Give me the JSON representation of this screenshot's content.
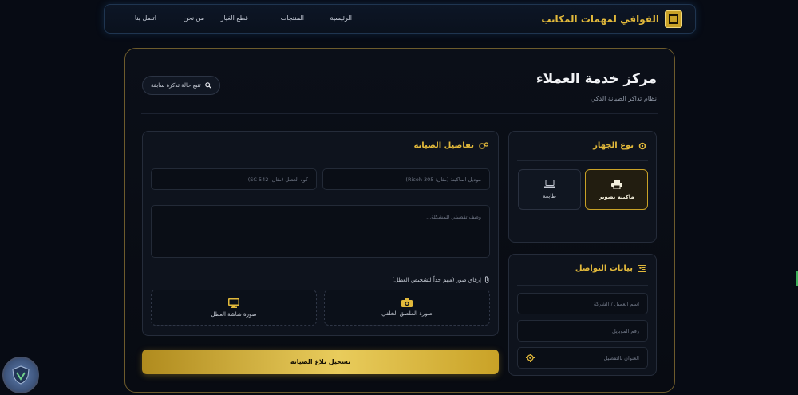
{
  "nav": {
    "brand": "الفوافي لمهمات المكاتب",
    "brand_logo_text": "الفوافي",
    "links": [
      "الرئيسية",
      "المنتجات",
      "قطع الغيار",
      "من نحن",
      "اتصل بنا"
    ]
  },
  "page": {
    "title": "مركز خدمة العملاء",
    "subtitle": "نظام تذاكر الصيانة الذكي",
    "track_button": "تتبع حالة تذكرة سابقة"
  },
  "device": {
    "heading": "نوع الجهاز",
    "options": [
      {
        "label": "ماكينة تصوير",
        "icon": "printer-icon",
        "selected": true
      },
      {
        "label": "طابعة",
        "icon": "laptop-icon",
        "selected": false
      }
    ]
  },
  "contact": {
    "heading": "بيانات التواصل",
    "name_placeholder": "اسم العميل / الشركة",
    "phone_placeholder": "رقم الموبايل",
    "address_placeholder": "العنوان بالتفصيل"
  },
  "maintenance": {
    "heading": "تفاصيل الصيانة",
    "model_placeholder": "موديل الماكينة (مثال: Ricoh 305)",
    "error_code_placeholder": "كود العطل (مثال: SC 542)",
    "description_placeholder": "وصف تفصيلي للمشكلة...",
    "attach_label": "إرفاق صور (مهم جداً لتشخيص العطل)",
    "upload_sticker": "صورة الملصق الخلفي",
    "upload_screen": "صورة شاشة العطل"
  },
  "submit_label": "تسجيل بلاغ الصيانة",
  "colors": {
    "accent": "#e2b93b",
    "background": "#070b14",
    "panel": "#0e131d"
  }
}
